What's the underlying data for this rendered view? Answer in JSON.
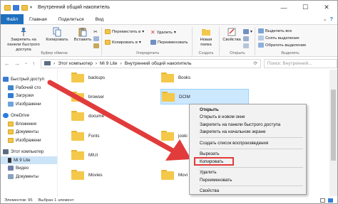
{
  "window": {
    "title": "Внутренний общий накопитель",
    "controls": [
      "—",
      "☐",
      "✕"
    ]
  },
  "ribbon_tabs": {
    "file": "Файл",
    "home": "Главная",
    "share": "Поделиться",
    "view": "Вид",
    "help_glyph": "?"
  },
  "ribbon": {
    "pin_label": "Закрепить на панели быстрого доступа",
    "copy_label": "Копировать",
    "paste_label": "Вставить",
    "clipboard_group": "Буфер обмена",
    "move_to": "Переместить в",
    "copy_to": "Копировать в",
    "delete": "Удалить",
    "rename": "Переименовать",
    "organize_group": "Упорядочить",
    "new_folder": "Новая папка",
    "create_group": "Создать",
    "properties": "Свойства",
    "open_group": "Открыть",
    "select_all": "Выделить все",
    "select_none": "Снять выделение",
    "invert_selection": "Обратить выделение",
    "select_group": "Выделить"
  },
  "address": {
    "path": [
      "Этот компьютер",
      "Mi 9 Lite",
      "Внутренний общий накопитель"
    ],
    "separator": "›",
    "search_placeholder": "Поиск: Внутренний..."
  },
  "nav_pane": {
    "items": [
      {
        "label": "Быстрый доступ"
      },
      {
        "label": "Рабочий сто"
      },
      {
        "label": "Загрузки"
      },
      {
        "label": "Изображени"
      },
      {
        "label": "OneDrive"
      },
      {
        "label": "Вложения"
      },
      {
        "label": "Документы"
      },
      {
        "label": "Изображени"
      },
      {
        "label": "Этот компьютер"
      },
      {
        "label": "Mi 9 Lite"
      },
      {
        "label": "Видео"
      },
      {
        "label": "Документы"
      }
    ]
  },
  "folders": {
    "col1": [
      "backups",
      "browser",
      "docume",
      "Fonts",
      "MIUI",
      "Movies"
    ],
    "col2": [
      "Books",
      "DCIM",
      "jooki",
      "Movi"
    ]
  },
  "context_menu": {
    "open": "Открыть",
    "open_new_window": "Открыть в новом окне",
    "pin_quick": "Закрепить на панели быстрого доступа",
    "pin_start": "Закрепить на начальном экране",
    "create_playlist": "Создать список воспроизведения",
    "cut": "Вырезать",
    "copy": "Копировать",
    "delete": "Удалить",
    "rename": "Переименовать",
    "properties": "Свойства"
  },
  "statusbar": {
    "items_count": "Элементов: 95",
    "selected": "Выбран 1 элемент"
  },
  "colors": {
    "accent": "#1f6fbf",
    "arrow": "#e23b3b",
    "folder": "#f4c84a"
  }
}
